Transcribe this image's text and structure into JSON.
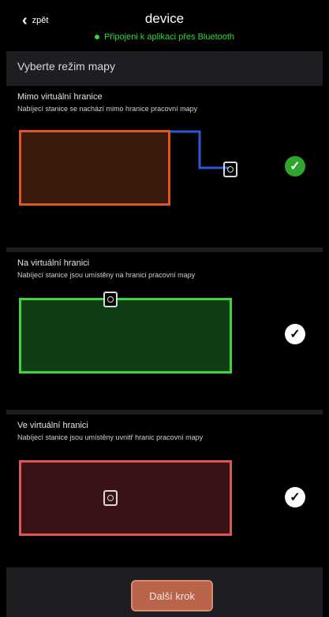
{
  "header": {
    "back_label": "zpět",
    "title": "device",
    "status": "Připojeni k aplikaci přes Bluetooth",
    "status_color": "#36d63a"
  },
  "section_title": "Vyberte režim mapy",
  "options": [
    {
      "title": "Mimo virtuální hranice",
      "description": "Nabíjecí stanice se nachází mimo hranice pracovní mapy",
      "border_color": "#e0561f",
      "fill_color": "#3a1a0c",
      "selected": true
    },
    {
      "title": "Na virtuální hranici",
      "description": "Nabíjecí stanice jsou umístěny na hranici pracovní mapy",
      "border_color": "#3fd43f",
      "fill_color": "#0f3e14",
      "selected": false
    },
    {
      "title": "Ve virtuální hranici",
      "description": "Nabíjecí stanice jsou umístěny uvnitř hranic pracovní mapy",
      "border_color": "#d95a52",
      "fill_color": "#3a1216",
      "selected": false
    }
  ],
  "footer": {
    "next_label": "Další krok"
  },
  "icons": {
    "back": "chevron-left-icon",
    "dock": "charging-station-icon",
    "check": "checkmark-icon"
  }
}
